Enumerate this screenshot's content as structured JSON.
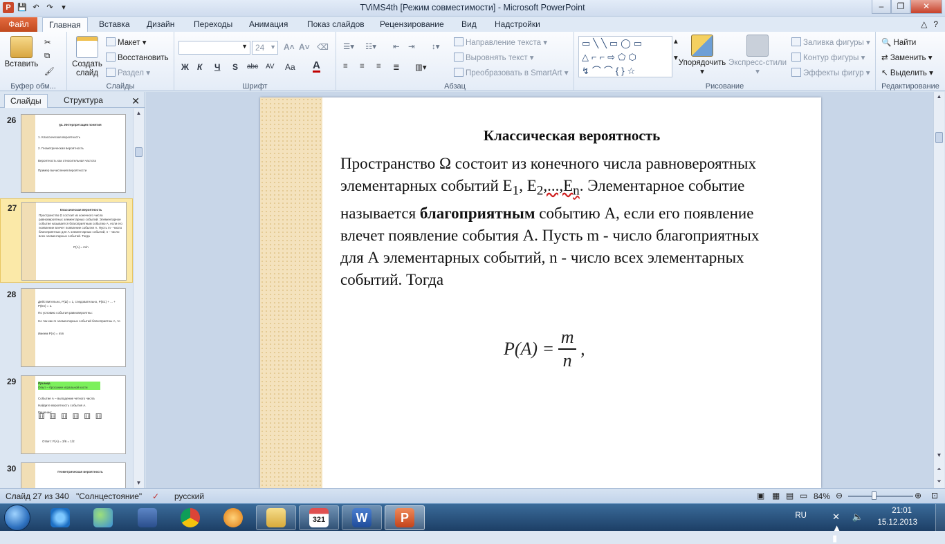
{
  "window": {
    "title": "TViMS4th [Режим совместимости]  -  Microsoft PowerPoint",
    "controls": [
      "–",
      "❐",
      "✕"
    ]
  },
  "ribbon_tabs": {
    "file": "Файл",
    "items": [
      "Главная",
      "Вставка",
      "Дизайн",
      "Переходы",
      "Анимация",
      "Показ слайдов",
      "Рецензирование",
      "Вид",
      "Надстройки"
    ],
    "active": "Главная"
  },
  "ribbon": {
    "clipboard": {
      "paste": "Вставить",
      "group": "Буфер обм..."
    },
    "slides": {
      "new_slide_1": "Создать",
      "new_slide_2": "слайд",
      "layout": "Макет",
      "reset": "Восстановить",
      "section": "Раздел",
      "group": "Слайды"
    },
    "font": {
      "name": "",
      "size": "24",
      "bold": "Ж",
      "italic": "К",
      "underline": "Ч",
      "shadow": "S",
      "strike": "abc",
      "spacing": "AV",
      "case": "Aa",
      "color": "A",
      "group": "Шрифт"
    },
    "paragraph": {
      "direction": "Направление текста",
      "align": "Выровнять текст",
      "smartart": "Преобразовать в SmartArt",
      "group": "Абзац"
    },
    "drawing": {
      "arrange": "Упорядочить",
      "quick_styles": "Экспресс-стили",
      "fill": "Заливка фигуры",
      "outline": "Контур фигуры",
      "effects": "Эффекты фигур",
      "group": "Рисование"
    },
    "editing": {
      "find": "Найти",
      "replace": "Заменить",
      "select": "Выделить",
      "group": "Редактирование"
    }
  },
  "panel": {
    "tab_slides": "Слайды",
    "tab_outline": "Структура",
    "thumbnails": [
      {
        "num": "26",
        "lines": [
          "§4. Интерпретация понятия",
          "1. Классическая вероятность",
          "2. Геометрическая вероятность",
          "Вероятность как относительная частота",
          "Пример вычисления вероятности"
        ]
      },
      {
        "num": "27",
        "lines": [
          "Классическая вероятность",
          "Пространство Ω состоит из конечного числа равновероятных элементарных событий. Элементарное событие называется благоприятным событию А, если его появление влечет появление события А. Пусть m - число благоприятных для А элементарных событий, n - число всех элементарных событий. Тогда",
          "P(A) = m/n"
        ]
      },
      {
        "num": "28",
        "lines": [
          "Действительно, P(Ω) = 1, следовательно, P(E1) + ... + P(En) = 1.",
          "По условию события равновероятны:",
          "Но так как m элементарных событий благоприятны А, то",
          "Имеем P(A) = m/n"
        ]
      },
      {
        "num": "29",
        "lines": [
          "Пример.",
          "Опыт – бросание игральной кости",
          "Событие А – выпадение четного числа",
          "Найдите вероятность события А.",
          "Решение:",
          "Ответ: P(A) = 3/6 = 1/2"
        ]
      },
      {
        "num": "30",
        "lines": [
          "Геометрическая вероятность"
        ]
      }
    ]
  },
  "slide": {
    "title": "Классическая вероятность",
    "body_1": "Пространство Ω состоит из конечного числа равновероятных элементарных событий E",
    "sub_1": "1",
    "comma_1": ", E",
    "sub_2": "2",
    "dots": ",...,E",
    "sub_n": "n",
    "period": ".",
    "body_2": " Элементарное событие называется ",
    "bold_word": "благоприятным",
    "body_3": " событию А, если его появление влечет появление события А. Пусть m - число благоприятных для А элементарных событий, n - число всех элементарных событий. Тогда",
    "formula_lhs": "P(A) =",
    "formula_num": "m",
    "formula_den": "n",
    "formula_tail": ","
  },
  "status": {
    "slide_of": "Слайд 27 из 340",
    "theme": "\"Солнцестояние\"",
    "language": "русский",
    "zoom": "84%"
  },
  "taskbar": {
    "lang": "RU",
    "time": "21:01",
    "date": "15.12.2013"
  }
}
